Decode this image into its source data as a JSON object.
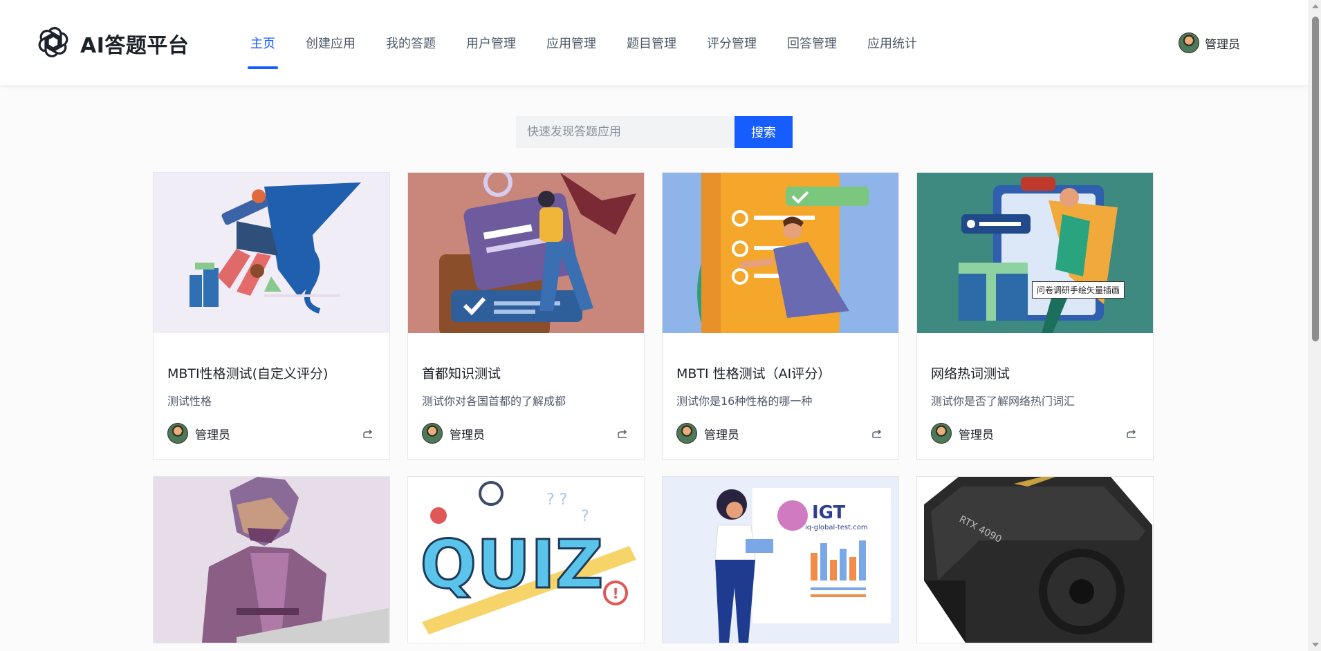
{
  "app": {
    "title": "AI答题平台"
  },
  "nav": {
    "items": [
      {
        "label": "主页",
        "active": true
      },
      {
        "label": "创建应用",
        "active": false
      },
      {
        "label": "我的答题",
        "active": false
      },
      {
        "label": "用户管理",
        "active": false
      },
      {
        "label": "应用管理",
        "active": false
      },
      {
        "label": "题目管理",
        "active": false
      },
      {
        "label": "评分管理",
        "active": false
      },
      {
        "label": "回答管理",
        "active": false
      },
      {
        "label": "应用统计",
        "active": false
      }
    ]
  },
  "user": {
    "name": "管理员"
  },
  "search": {
    "placeholder": "快速发现答题应用",
    "value": "",
    "button": "搜索"
  },
  "cards": [
    {
      "title": "MBTI性格测试(自定义评分)",
      "desc": "测试性格",
      "author": "管理员",
      "cover_bg": "#f1edf6",
      "cover_icon": "person-writing-illustration"
    },
    {
      "title": "首都知识测试",
      "desc": "测试你对各国首都的了解成都",
      "author": "管理员",
      "cover_bg": "#c8877a",
      "cover_icon": "wallet-checklist-illustration"
    },
    {
      "title": "MBTI 性格测试（AI评分）",
      "desc": "测试你是16种性格的哪一种",
      "author": "管理员",
      "cover_bg": "#8fb4ea",
      "cover_icon": "checklist-illustration"
    },
    {
      "title": "网络热词测试",
      "desc": "测试你是否了解网络热门词汇",
      "author": "管理员",
      "cover_bg": "#3f8a80",
      "cover_icon": "survey-illustration",
      "cover_caption": "问卷调研手绘矢量插画"
    },
    {
      "cover_bg": "#e6dde8",
      "cover_icon": "low-poly-man-illustration"
    },
    {
      "cover_bg": "#ffffff",
      "cover_icon": "quiz-illustration",
      "cover_text": "QUIZ"
    },
    {
      "cover_bg": "#e9eefb",
      "cover_icon": "iq-test-illustration",
      "cover_text": "IGT",
      "cover_subtext": "iq-global-test.com"
    },
    {
      "cover_bg": "#ffffff",
      "cover_icon": "graphics-card-image",
      "cover_text": "RTX 4090"
    }
  ]
}
